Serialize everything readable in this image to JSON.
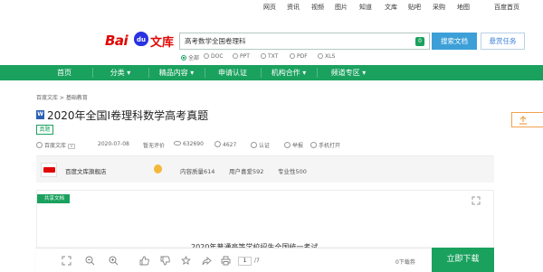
{
  "top_links": [
    "网页",
    "资讯",
    "视频",
    "图片",
    "知道",
    "文库",
    "贴吧",
    "采购",
    "地图",
    "百度首页"
  ],
  "logo": {
    "bai": "Bai",
    "du": "du",
    "wenku": "文库"
  },
  "search": {
    "value": "高考数学全国卷理科",
    "clear_label": "0"
  },
  "buttons": {
    "search": "搜索文档",
    "task": "悬赏任务",
    "download": "立即下载"
  },
  "filters": [
    "全部",
    "DOC",
    "PPT",
    "TXT",
    "PDF",
    "XLS"
  ],
  "nav": [
    "首页",
    "分类 ▾",
    "精品内容 ▾",
    "申请认证",
    "机构合作 ▾",
    "频道专区 ▾"
  ],
  "breadcrumb": "百度文库 > 基础教育",
  "doc": {
    "type_icon": "W",
    "title": "2020年全国Ⅰ卷理科数学高考真题",
    "tag": "真题",
    "author": "百度文库",
    "date": "2020-07-08",
    "rating": "暂无评价",
    "views": "632690",
    "downloads": "4627",
    "certified": "认证",
    "report": "举报",
    "mobile": "手机打开",
    "first_line": "2020年普通高等学校招生全国统一考试"
  },
  "author_bar": {
    "name": "百度文库旗舰店",
    "stats": [
      "内容质量614",
      "用户喜爱592",
      "专业性500"
    ]
  },
  "ribbon": "共享文档",
  "pager": {
    "current": "1",
    "total": "/7"
  },
  "coupon": "0下载券",
  "colors": {
    "brand_green": "#1aa15e",
    "search_blue": "#3c9fd8",
    "logo_red": "#e10602"
  }
}
